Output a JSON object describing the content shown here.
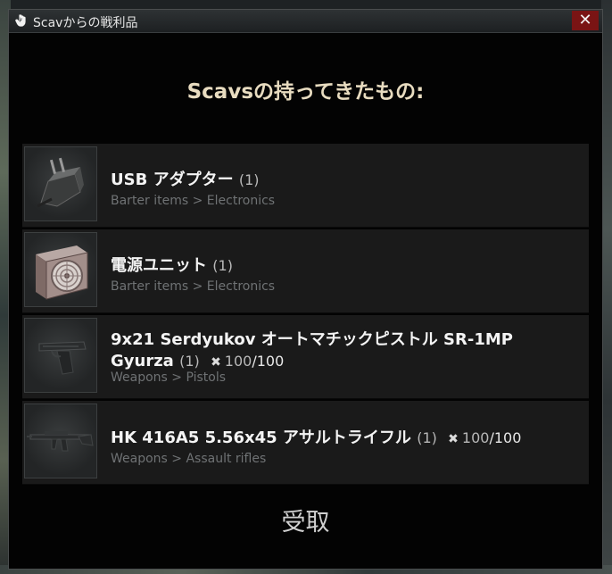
{
  "window": {
    "title": "Scavからの戦利品",
    "close_label": "✕"
  },
  "heading": "Scavsの持ってきたもの:",
  "items": [
    {
      "name": "USB アダプター",
      "qty": "(1)",
      "category": "Barter items > Electronics",
      "icon": "usb-adapter-icon"
    },
    {
      "name": "電源ユニット",
      "qty": "(1)",
      "category": "Barter items > Electronics",
      "icon": "power-supply-icon"
    },
    {
      "name_line1": "9x21 Serdyukov オートマチックピストル SR-1MP",
      "name_line2": "Gyurza",
      "qty": "(1)",
      "durability": "100",
      "durability_max": "/100",
      "category": "Weapons > Pistols",
      "icon": "pistol-icon"
    },
    {
      "name": "HK 416A5 5.56x45 アサルトライフル",
      "qty": "(1)",
      "durability": "100",
      "durability_max": "/100",
      "category": "Weapons > Assault rifles",
      "icon": "assault-rifle-icon"
    }
  ],
  "take_label": "受取",
  "colors": {
    "close_button": "#7a1414",
    "heading": "#e8dcc0",
    "row_bg": "#1a1a1a",
    "category_text": "#6f7274"
  }
}
